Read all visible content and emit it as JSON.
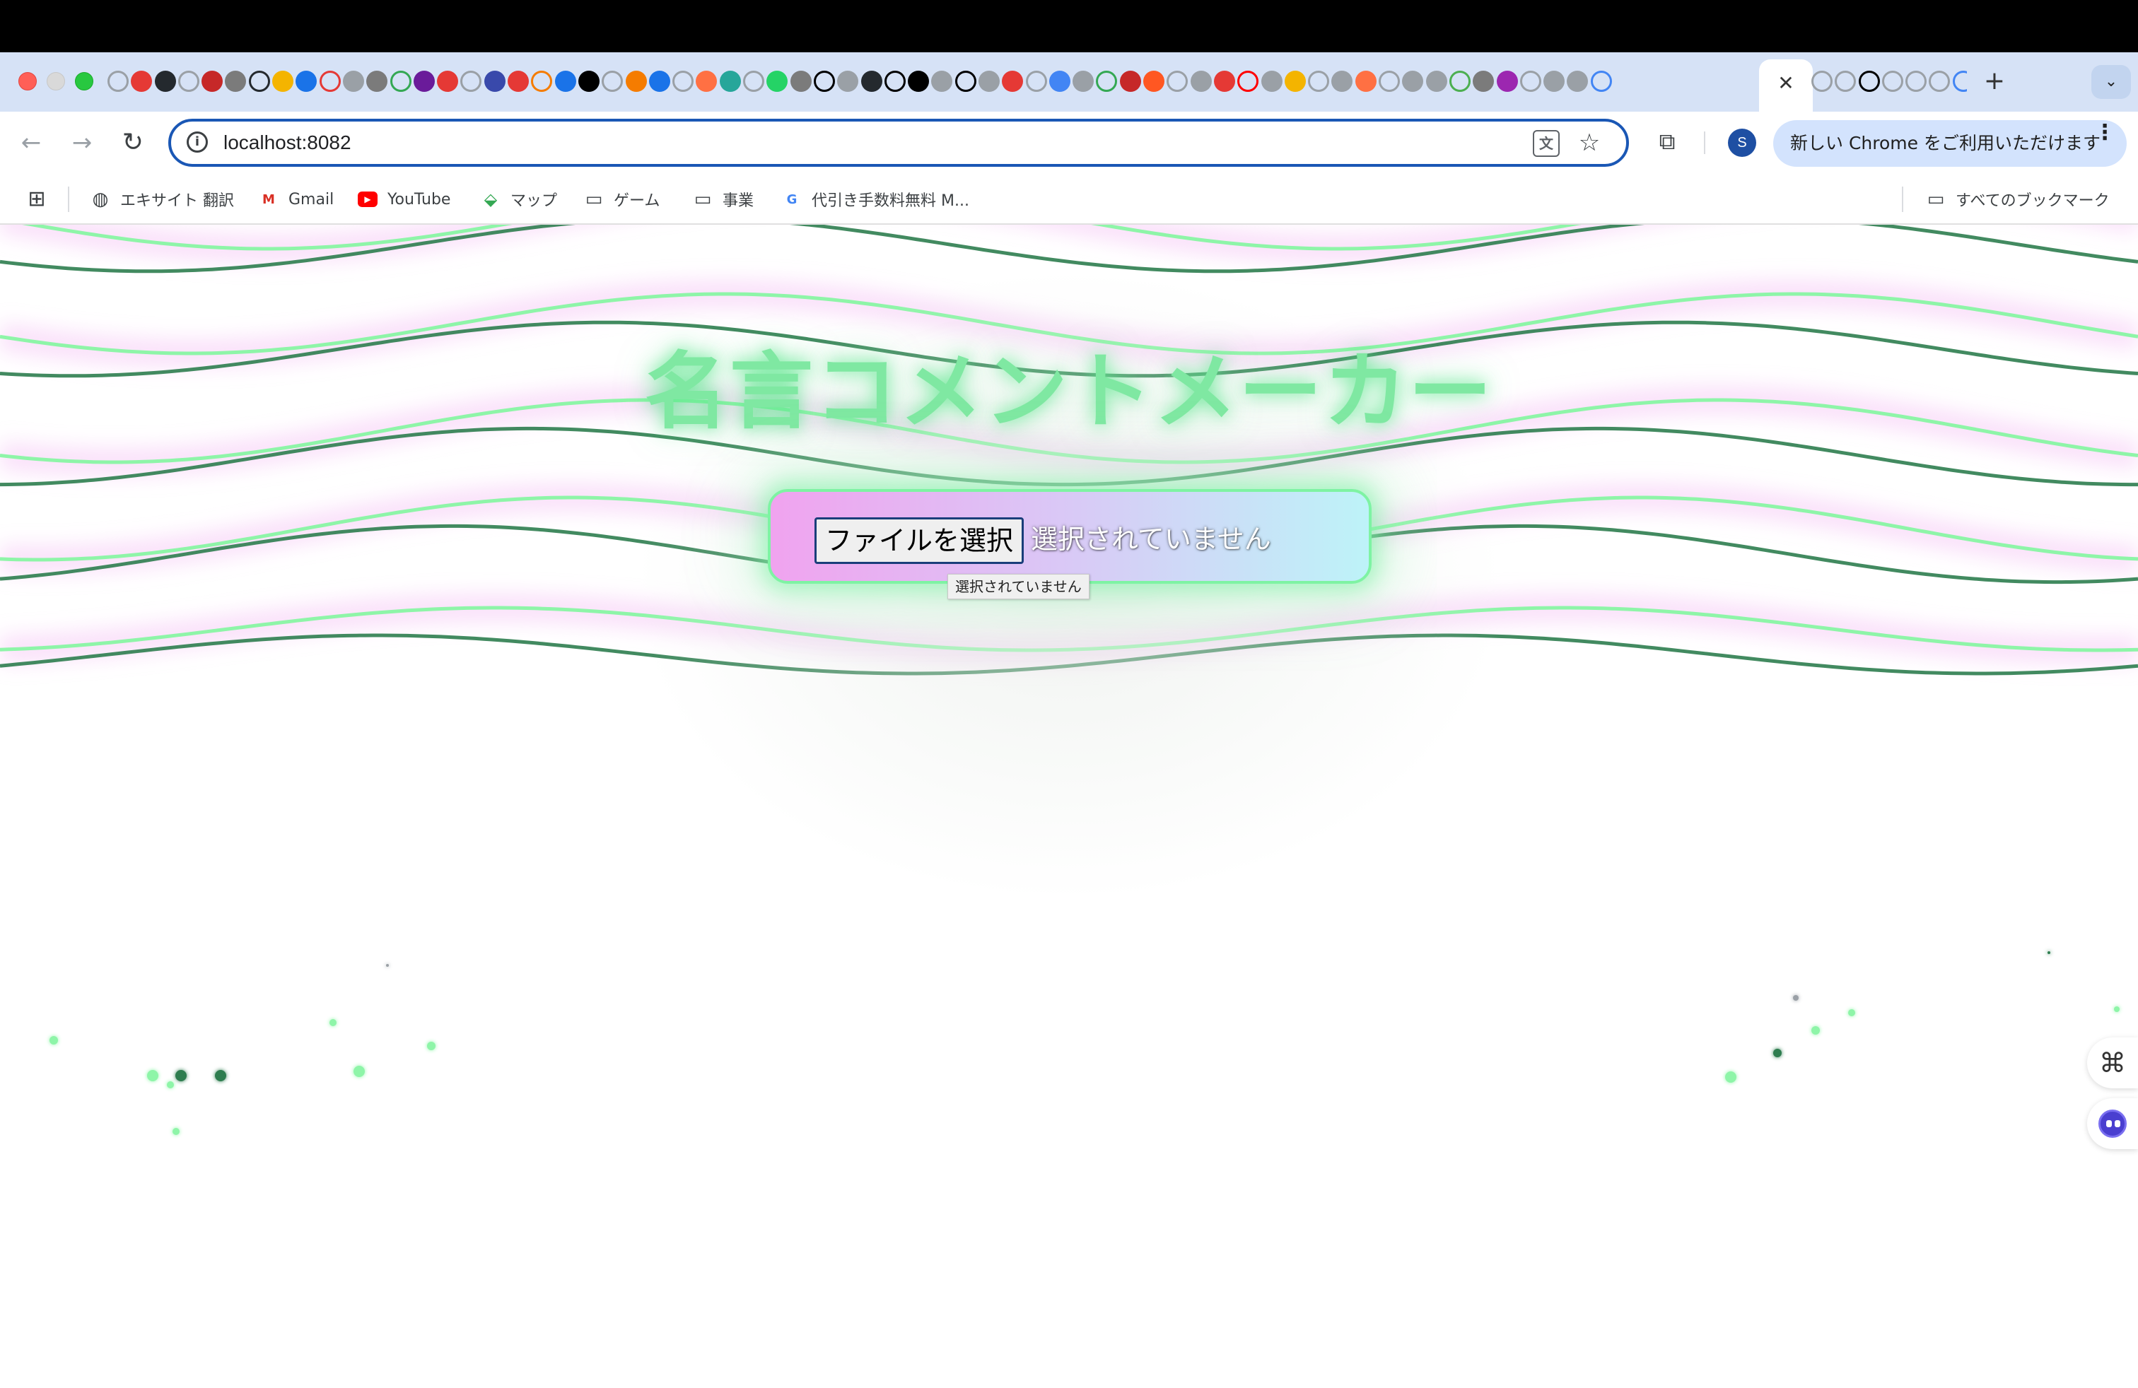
{
  "browser": {
    "tab_close_symbol": "✕",
    "new_tab_symbol": "+",
    "tab_search_symbol": "⌄",
    "url": "localhost:8082",
    "profile_initial": "S",
    "chrome_promo": "新しい Chrome をご利用いただけます",
    "menu_dots": "⋮",
    "nav": {
      "back": "←",
      "forward": "→",
      "reload": "↻"
    }
  },
  "bookmarks": [
    {
      "label": "エキサイト 翻訳",
      "icon": "globe-icon"
    },
    {
      "label": "Gmail",
      "icon": "gmail-icon"
    },
    {
      "label": "YouTube",
      "icon": "youtube-icon"
    },
    {
      "label": "マップ",
      "icon": "maps-icon"
    },
    {
      "label": "ゲーム",
      "icon": "folder-icon"
    },
    {
      "label": "事業",
      "icon": "folder-icon"
    },
    {
      "label": "代引き手数料無料 M...",
      "icon": "google-icon"
    }
  ],
  "all_bookmarks": "すべてのブックマーク",
  "app": {
    "title": "名言コメントメーカー",
    "file_button": "ファイルを選択",
    "file_status": "選択されていません",
    "tooltip": "選択されていません"
  },
  "colors": {
    "title_glow": "#7fe8a2",
    "wave_light": "#8ef5a8",
    "wave_dark": "#2e7d4f",
    "omnibox_border": "#1a57b5"
  }
}
